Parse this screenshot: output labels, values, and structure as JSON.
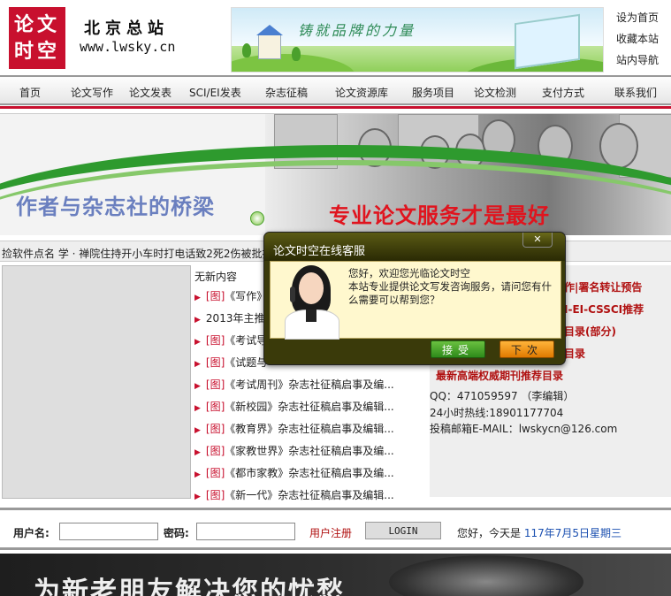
{
  "header": {
    "logo_line1": "论文",
    "logo_line2": "时空",
    "site_name": "北京总站",
    "site_url": "www.lwsky.cn",
    "banner_slogan": "铸就品牌的力量",
    "top_links": [
      "设为首页",
      "收藏本站",
      "站内导航"
    ]
  },
  "nav": {
    "items": [
      "首页",
      "论文写作",
      "论文发表",
      "SCI/EI发表",
      "杂志征稿",
      "论文资源库",
      "服务项目",
      "论文检测",
      "支付方式",
      "联系我们"
    ]
  },
  "hero": {
    "left_text": "作者与杂志社的桥梁",
    "right_text": "专业论文服务才是最好"
  },
  "ticker": {
    "text": "捡软件点名 学 · 禅院住持开小车时打电话致2死2伤被批捕"
  },
  "list": {
    "header": "无新内容",
    "items": [
      {
        "tag": "[图]",
        "text": "《写作》"
      },
      {
        "tag": "",
        "text": "2013年主推"
      },
      {
        "tag": "[图]",
        "text": "《考试导"
      },
      {
        "tag": "[图]",
        "text": "《试题与"
      },
      {
        "tag": "[图]",
        "text": "《考试周刊》杂志社征稿启事及编..."
      },
      {
        "tag": "[图]",
        "text": "《新校园》杂志社征稿启事及编辑..."
      },
      {
        "tag": "[图]",
        "text": "《教育界》杂志社征稿启事及编辑..."
      },
      {
        "tag": "[图]",
        "text": "《家教世界》杂志社征稿启事及编..."
      },
      {
        "tag": "[图]",
        "text": "《都市家教》杂志社征稿启事及编..."
      },
      {
        "tag": "[图]",
        "text": "《新一代》杂志社征稿启事及编辑..."
      }
    ]
  },
  "right": {
    "links": [
      "作|署名转让预告",
      "I-EI-CSSCI推荐",
      "目录(部分)",
      "目录",
      "最新高端权威期刊推荐目录"
    ],
    "qq": "QQ：471059597 （李编辑）",
    "hotline": "24小时热线:18901177704",
    "email": "投稿邮箱E-MAIL：lwskycn@126.com"
  },
  "login": {
    "username_label": "用户名:",
    "password_label": "密码:",
    "register": "用户注册",
    "login_button": "LOGIN",
    "greeting": "您好，今天是",
    "date": "117年7月5日星期三"
  },
  "bottom_banner": {
    "text": "为新老朋友解决您的忧愁"
  },
  "chat": {
    "title": "论文时空在线客服",
    "close": "✕",
    "message": "您好，欢迎您光临论文时空\n本站专业提供论文写发咨询服务，请问您有什么需要可以帮到您？",
    "accept": "接受",
    "next": "下次"
  },
  "colors": {
    "brand_red": "#c8102e",
    "chat_bg": "#3a3a0a",
    "accept_green": "#2e8a1a",
    "next_orange": "#e07a00"
  }
}
